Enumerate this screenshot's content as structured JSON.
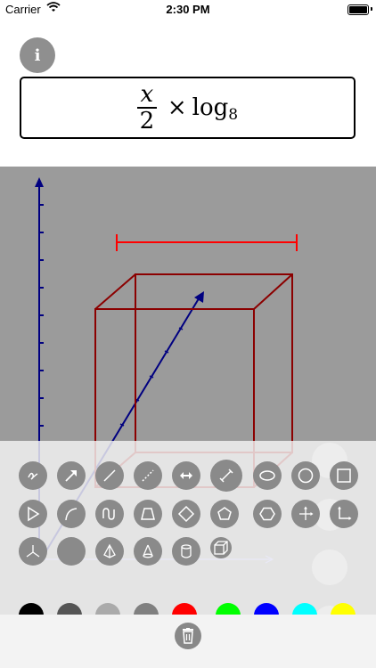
{
  "status_bar": {
    "carrier": "Carrier",
    "time": "2:30 PM"
  },
  "info_button": {
    "label": "i"
  },
  "formula": {
    "numerator": "x",
    "denominator": "2",
    "operator": "×",
    "function": "log",
    "subscript": "8"
  },
  "tools": [
    {
      "name": "freehand",
      "icon": "freehand-squiggle-icon"
    },
    {
      "name": "arrow",
      "icon": "arrow-icon"
    },
    {
      "name": "line",
      "icon": "line-icon"
    },
    {
      "name": "dashed-line",
      "icon": "dashed-line-icon"
    },
    {
      "name": "double-arrow",
      "icon": "double-arrow-icon"
    },
    {
      "name": "measure",
      "icon": "measure-line-icon"
    },
    {
      "name": "ellipse",
      "icon": "ellipse-icon"
    },
    {
      "name": "circle",
      "icon": "circle-icon"
    },
    {
      "name": "square",
      "icon": "square-icon"
    },
    {
      "name": "triangle",
      "icon": "triangle-icon"
    },
    {
      "name": "arc",
      "icon": "arc-icon"
    },
    {
      "name": "wave",
      "icon": "wave-icon"
    },
    {
      "name": "trapezoid",
      "icon": "trapezoid-icon"
    },
    {
      "name": "diamond",
      "icon": "diamond-icon"
    },
    {
      "name": "pentagon",
      "icon": "pentagon-icon"
    },
    {
      "name": "hexagon",
      "icon": "hexagon-icon"
    },
    {
      "name": "axes",
      "icon": "axes-cross-icon"
    },
    {
      "name": "right-angle",
      "icon": "right-angle-axis-icon"
    },
    {
      "name": "3d-axes",
      "icon": "3d-axes-icon"
    },
    {
      "name": "sphere",
      "icon": "sphere-icon"
    },
    {
      "name": "pyramid",
      "icon": "pyramid-icon"
    },
    {
      "name": "cone",
      "icon": "cone-icon"
    },
    {
      "name": "cylinder",
      "icon": "cylinder-icon"
    },
    {
      "name": "cube",
      "icon": "cube-icon"
    }
  ],
  "colors": [
    "#000000",
    "#555555",
    "#aaaaaa",
    "#808080",
    "#ff0000",
    "#00ff00",
    "#0000ff",
    "#00ffff",
    "#ffff00"
  ],
  "drawing": {
    "box_color": "#8b0000",
    "dimension_color": "#ff0000",
    "axis_color": "#000080"
  },
  "trash": {
    "icon": "trash-icon"
  }
}
